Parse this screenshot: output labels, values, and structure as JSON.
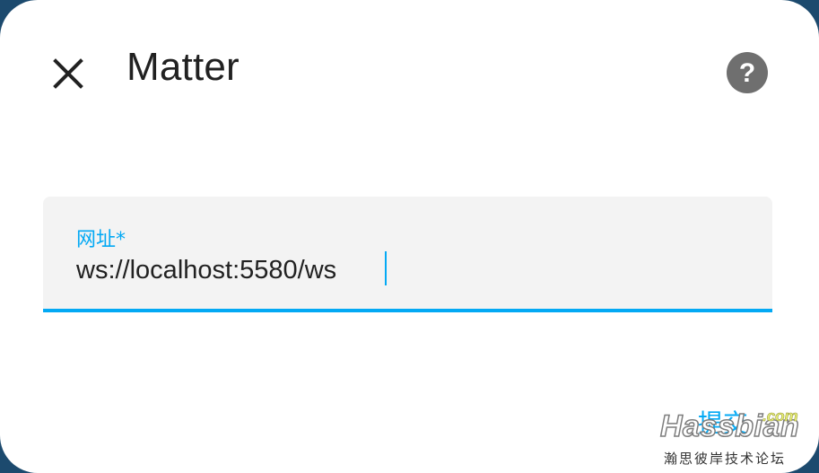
{
  "dialog": {
    "title": "Matter",
    "close_icon": "close-icon",
    "help_icon": "help-circle-icon"
  },
  "form": {
    "url_label": "网址*",
    "url_value": "ws://localhost:5580/ws"
  },
  "actions": {
    "submit_label": "提交"
  },
  "watermark": {
    "logo": "Hassbian",
    "domain": ".com",
    "subtitle": "瀚思彼岸技术论坛"
  },
  "colors": {
    "accent": "#03a9f4",
    "field_bg": "#f3f3f3",
    "text": "#212121",
    "icon_gray": "#6f6f6f",
    "backdrop": "#1c4a6e"
  }
}
